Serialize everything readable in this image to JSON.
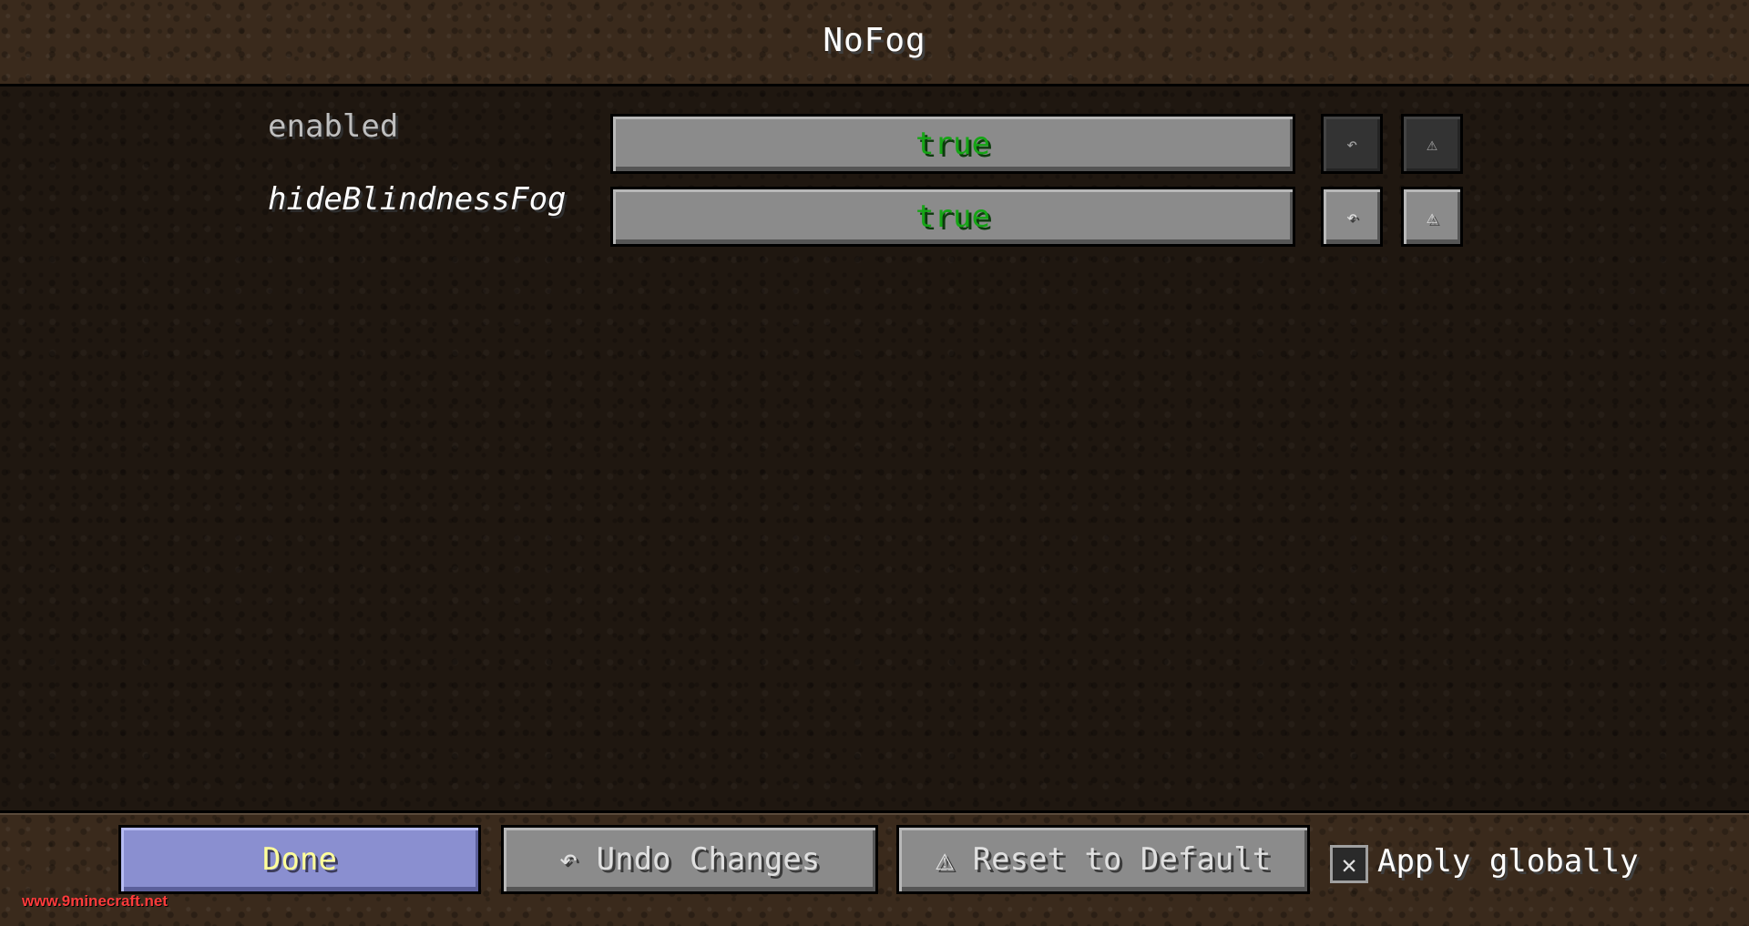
{
  "header": {
    "title": "NoFog"
  },
  "options": [
    {
      "label": "enabled",
      "value": "true",
      "undo_icon": "↶",
      "reset_icon": "⚠"
    },
    {
      "label": "hideBlindnessFog",
      "value": "true",
      "undo_icon": "↶",
      "reset_icon": "⚠"
    }
  ],
  "footer": {
    "done_label": "Done",
    "undo_label": "↶ Undo Changes",
    "reset_label": "⚠ Reset to Default",
    "apply_globally_mark": "✕",
    "apply_globally_label": "Apply globally"
  },
  "watermark": "www.9minecraft.net",
  "colors": {
    "value_true": "#16a516",
    "done_text": "#ffff9a",
    "done_bg": "#8a8fd0"
  }
}
